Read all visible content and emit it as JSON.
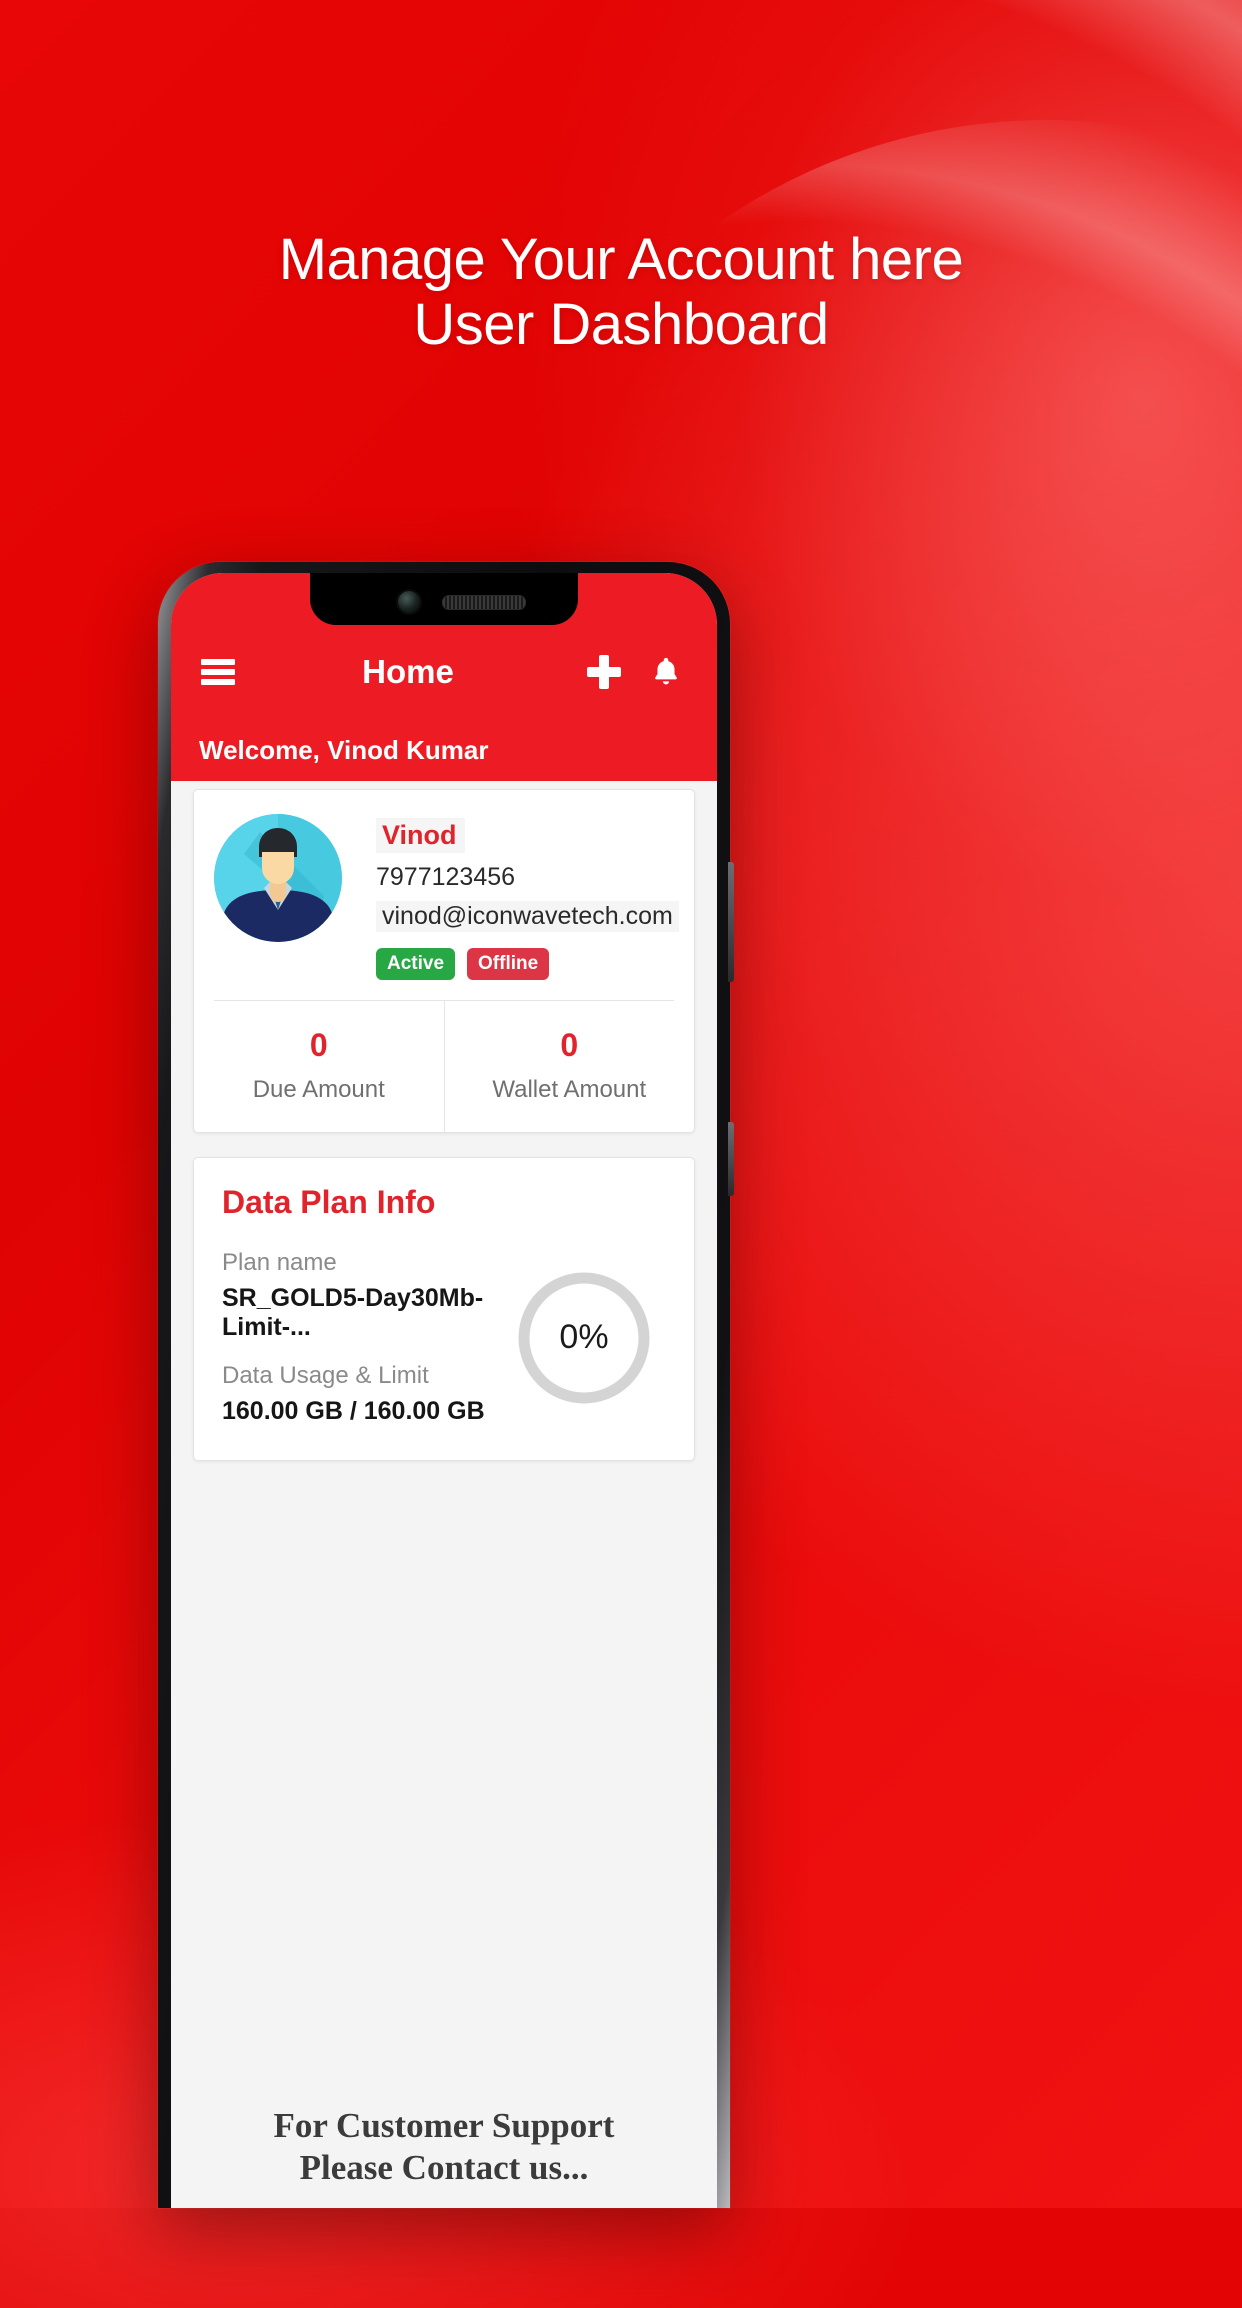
{
  "promo": {
    "headline_line1": "Manage Your Account here",
    "headline_line2": "User Dashboard",
    "background_color": "#e30505"
  },
  "appbar": {
    "menu_icon": "hamburger-icon",
    "title": "Home",
    "add_icon": "plus-icon",
    "notification_icon": "bell-icon",
    "background_color": "#ed1c24"
  },
  "welcome": {
    "text": "Welcome, Vinod Kumar"
  },
  "profile": {
    "avatar_icon": "user-avatar-icon",
    "name": "Vinod",
    "phone": "7977123456",
    "email": "vinod@iconwavetech.com",
    "status_badge": "Active",
    "connection_badge": "Offline",
    "status_color": "#28a745",
    "connection_color": "#dc3545"
  },
  "amounts": [
    {
      "value": "0",
      "label": "Due Amount"
    },
    {
      "value": "0",
      "label": "Wallet Amount"
    }
  ],
  "data_plan": {
    "title": "Data Plan Info",
    "plan_name_label": "Plan name",
    "plan_name_value": "SR_GOLD5-Day30Mb-Limit-...",
    "usage_label": "Data Usage & Limit",
    "usage_value": "160.00 GB / 160.00 GB",
    "percent_text": "0%",
    "percent_value": 0,
    "gauge_track_color": "#d4d4d4",
    "gauge_fill_color": "#e0242c"
  },
  "support": {
    "line1": "For Customer Support",
    "line2": "Please Contact us..."
  },
  "accent": {
    "red": "#e0242c",
    "brand_red": "#ed1c24"
  }
}
